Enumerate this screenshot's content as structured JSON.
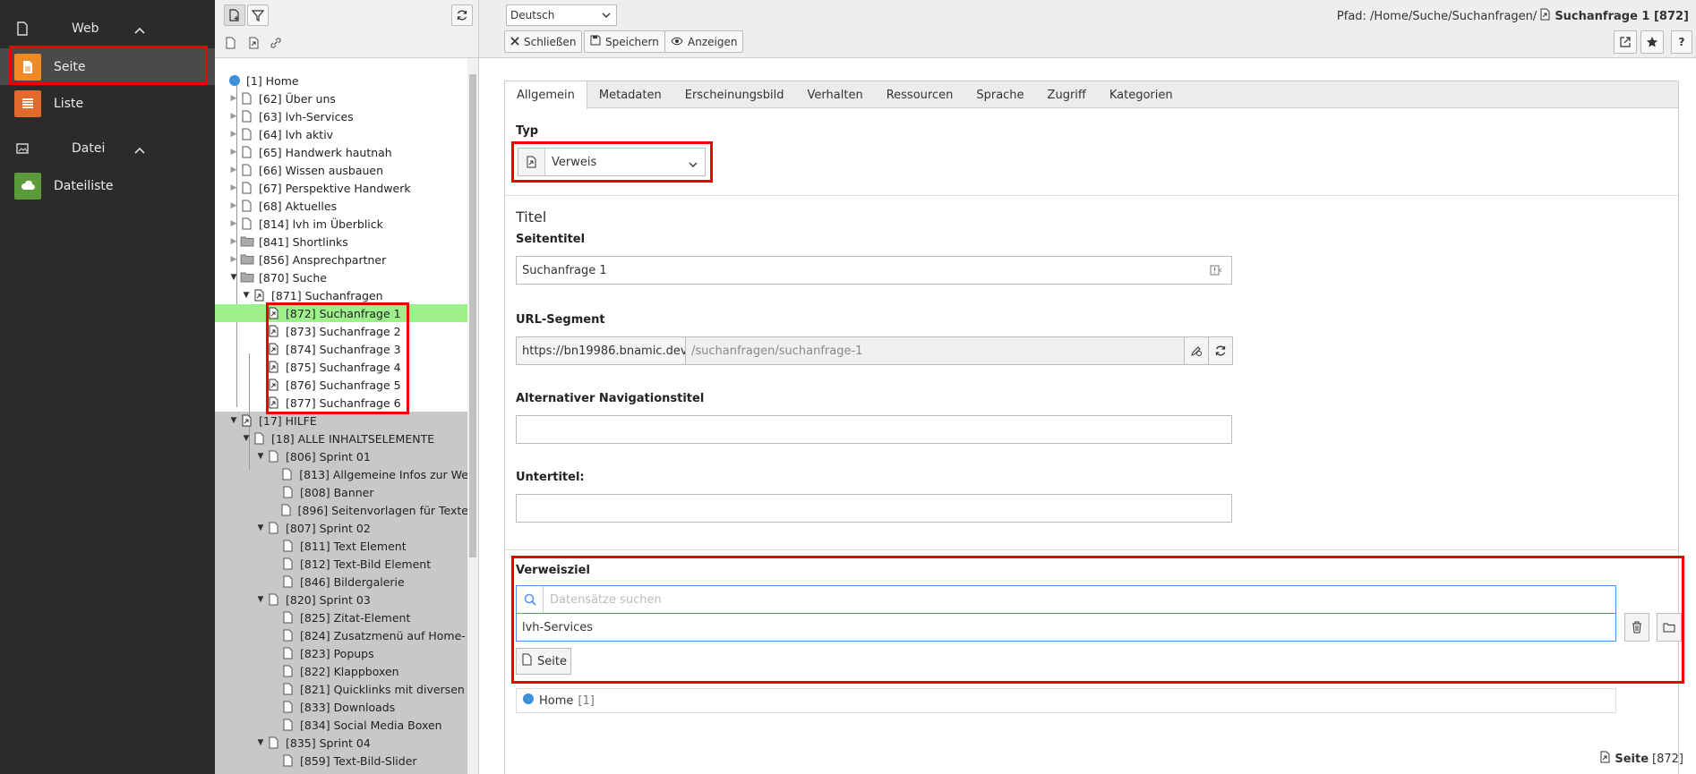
{
  "module_menu": {
    "groups": [
      {
        "label": "Web",
        "items": [
          {
            "label": "Seite"
          },
          {
            "label": "Liste"
          }
        ]
      },
      {
        "label": "Datei",
        "items": [
          {
            "label": "Dateiliste"
          }
        ]
      }
    ]
  },
  "page_tree": {
    "nodes": [
      {
        "label": "[1] Home"
      },
      {
        "label": "[62] Über uns"
      },
      {
        "label": "[63] lvh-Services"
      },
      {
        "label": "[64] lvh aktiv"
      },
      {
        "label": "[65] Handwerk hautnah"
      },
      {
        "label": "[66] Wissen ausbauen"
      },
      {
        "label": "[67] Perspektive Handwerk"
      },
      {
        "label": "[68] Aktuelles"
      },
      {
        "label": "[814] lvh im Überblick"
      },
      {
        "label": "[841] Shortlinks"
      },
      {
        "label": "[856] Ansprechpartner"
      },
      {
        "label": "[870] Suche"
      },
      {
        "label": "[871] Suchanfragen"
      },
      {
        "label": "[872] Suchanfrage 1"
      },
      {
        "label": "[873] Suchanfrage 2"
      },
      {
        "label": "[874] Suchanfrage 3"
      },
      {
        "label": "[875] Suchanfrage 4"
      },
      {
        "label": "[876] Suchanfrage 5"
      },
      {
        "label": "[877] Suchanfrage 6"
      },
      {
        "label": "[17] HILFE"
      },
      {
        "label": "[18] ALLE INHALTSELEMENTE"
      },
      {
        "label": "[806] Sprint 01"
      },
      {
        "label": "[813] Allgemeine Infos zur We"
      },
      {
        "label": "[808] Banner"
      },
      {
        "label": "[896] Seitenvorlagen für Texte"
      },
      {
        "label": "[807] Sprint 02"
      },
      {
        "label": "[811] Text Element"
      },
      {
        "label": "[812] Text-Bild Element"
      },
      {
        "label": "[846] Bildergalerie"
      },
      {
        "label": "[820] Sprint 03"
      },
      {
        "label": "[825] Zitat-Element"
      },
      {
        "label": "[824] Zusatzmenü auf Home-"
      },
      {
        "label": "[823] Popups"
      },
      {
        "label": "[822] Klappboxen"
      },
      {
        "label": "[821] Quicklinks mit diversen"
      },
      {
        "label": "[833] Downloads"
      },
      {
        "label": "[834] Social Media Boxen"
      },
      {
        "label": "[835] Sprint 04"
      },
      {
        "label": "[859] Text-Bild-Slider"
      }
    ]
  },
  "docheader": {
    "language": "Deutsch",
    "buttons": {
      "close": "Schließen",
      "save": "Speichern",
      "view": "Anzeigen"
    },
    "path_label": "Pfad: /Home/Suche/Suchanfragen/",
    "record_title": "Suchanfrage 1 [872]"
  },
  "form": {
    "tabs": [
      "Allgemein",
      "Metadaten",
      "Erscheinungsbild",
      "Verhalten",
      "Ressourcen",
      "Sprache",
      "Zugriff",
      "Kategorien"
    ],
    "type_label": "Typ",
    "type_value": "Verweis",
    "title_section": "Titel",
    "page_title_label": "Seitentitel",
    "page_title_value": "Suchanfrage 1",
    "url_segment_label": "URL-Segment",
    "url_base": "https://bn19986.bnamic.dev",
    "url_slug": "/suchanfragen/suchanfrage-1",
    "nav_title_label": "Alternativer Navigationstitel",
    "nav_title_value": "",
    "subtitle_label": "Untertitel:",
    "subtitle_value": "",
    "target_label": "Verweisziel",
    "search_placeholder": "Datensätze suchen",
    "target_value": "lvh-Services",
    "page_button": "Seite",
    "home_label": "Home",
    "home_id": "[1]"
  },
  "footer": {
    "label": "Seite",
    "id": "[872]"
  }
}
